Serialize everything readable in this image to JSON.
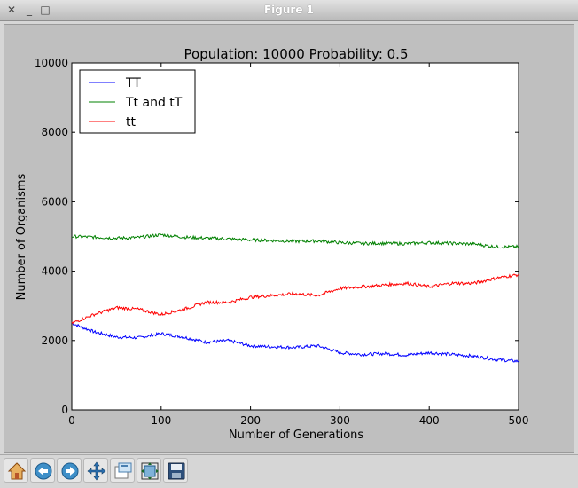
{
  "window": {
    "title": "Figure 1",
    "close_glyph": "✕",
    "minimize_glyph": "_",
    "maximize_glyph": "□"
  },
  "toolbar": {
    "buttons": [
      {
        "name": "home-icon",
        "tooltip": ""
      },
      {
        "name": "back-arrow-icon",
        "tooltip": ""
      },
      {
        "name": "forward-arrow-icon",
        "tooltip": ""
      },
      {
        "name": "pan-move-icon",
        "tooltip": ""
      },
      {
        "name": "zoom-rect-icon",
        "tooltip": ""
      },
      {
        "name": "subplot-config-icon",
        "tooltip": ""
      },
      {
        "name": "save-disk-icon",
        "tooltip": ""
      }
    ]
  },
  "chart_data": {
    "type": "line",
    "title": "Population: 10000 Probability: 0.5",
    "xlabel": "Number of Generations",
    "ylabel": "Number of Organisms",
    "xlim": [
      0,
      500
    ],
    "ylim": [
      0,
      10000
    ],
    "xticks": [
      "0",
      "100",
      "200",
      "300",
      "400",
      "500"
    ],
    "yticks": [
      "0",
      "2000",
      "4000",
      "6000",
      "8000",
      "10000"
    ],
    "legend_position": "top-left",
    "grid": false,
    "series": [
      {
        "name": "TT",
        "color": "#0000ff",
        "x": [
          0,
          25,
          50,
          75,
          100,
          125,
          150,
          175,
          200,
          225,
          250,
          275,
          300,
          325,
          350,
          375,
          400,
          425,
          450,
          475,
          500
        ],
        "values": [
          2500,
          2250,
          2100,
          2080,
          2200,
          2100,
          1950,
          2000,
          1850,
          1820,
          1800,
          1850,
          1650,
          1600,
          1620,
          1580,
          1650,
          1600,
          1550,
          1450,
          1400
        ]
      },
      {
        "name": "Tt and tT",
        "color": "#008000",
        "x": [
          0,
          25,
          50,
          75,
          100,
          125,
          150,
          175,
          200,
          225,
          250,
          275,
          300,
          325,
          350,
          375,
          400,
          425,
          450,
          475,
          500
        ],
        "values": [
          5000,
          4980,
          4950,
          4970,
          5050,
          4980,
          4950,
          4930,
          4900,
          4880,
          4860,
          4870,
          4820,
          4800,
          4800,
          4790,
          4820,
          4800,
          4780,
          4700,
          4700
        ]
      },
      {
        "name": "tt",
        "color": "#ff0000",
        "x": [
          0,
          25,
          50,
          75,
          100,
          125,
          150,
          175,
          200,
          225,
          250,
          275,
          300,
          325,
          350,
          375,
          400,
          425,
          450,
          475,
          500
        ],
        "values": [
          2500,
          2750,
          2950,
          2900,
          2750,
          2900,
          3100,
          3100,
          3250,
          3300,
          3350,
          3300,
          3500,
          3550,
          3600,
          3650,
          3550,
          3650,
          3650,
          3800,
          3900
        ]
      }
    ]
  }
}
